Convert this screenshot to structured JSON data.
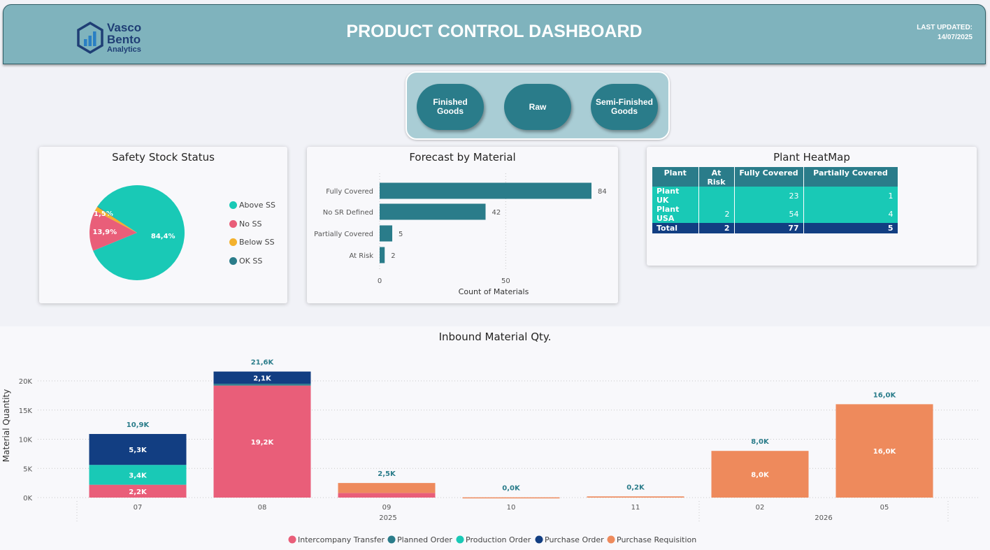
{
  "header": {
    "logo_line1": "Vasco",
    "logo_line2": "Bento",
    "logo_line3": "Analytics",
    "title": "PRODUCT CONTROL DASHBOARD",
    "updated_label": "LAST UPDATED:",
    "updated_value": "14/07/2025"
  },
  "slicer": {
    "buttons": [
      "Finished Goods",
      "Raw",
      "Semi-Finished Goods"
    ]
  },
  "heatmap": {
    "title": "Plant HeatMap",
    "columns": [
      "Plant",
      "At Risk",
      "Fully Covered",
      "Partially Covered"
    ],
    "rows": [
      {
        "plant": "Plant UK",
        "at_risk": "",
        "fully": "23",
        "partially": "1"
      },
      {
        "plant": "Plant USA",
        "at_risk": "2",
        "fully": "54",
        "partially": "4"
      }
    ],
    "total": {
      "plant": "Total",
      "at_risk": "2",
      "fully": "77",
      "partially": "5"
    }
  },
  "colors": {
    "teal": "#19c9b6",
    "pink": "#e95e79",
    "yellow": "#f3b12e",
    "darkteal": "#2a7c8a",
    "navy": "#123e82",
    "orange": "#ee8a5c"
  },
  "chart_data": [
    {
      "type": "pie",
      "title": "Safety Stock Status",
      "labels": [
        "Above SS",
        "No SS",
        "Below SS",
        "OK SS"
      ],
      "values": [
        84.4,
        13.9,
        1.5,
        0.2
      ],
      "data_labels": [
        "84,4%",
        "13,9%",
        "1,5%",
        ""
      ],
      "legend_position": "right"
    },
    {
      "type": "bar",
      "orientation": "horizontal",
      "title": "Forecast by Material",
      "categories": [
        "Fully Covered",
        "No SR Defined",
        "Partially Covered",
        "At Risk"
      ],
      "values": [
        84,
        42,
        5,
        2
      ],
      "xlabel": "Count of Materials",
      "xticks": [
        "0",
        "50"
      ],
      "xlim": [
        0,
        90
      ]
    },
    {
      "type": "bar",
      "stacked": true,
      "title": "Inbound Material Qty.",
      "ylabel": "Material Quantity",
      "categories": [
        "07",
        "08",
        "09",
        "10",
        "11",
        "02",
        "05"
      ],
      "year_groups": [
        {
          "label": "2025",
          "count": 5
        },
        {
          "label": "2026",
          "count": 2
        }
      ],
      "yticks": [
        "0K",
        "5K",
        "10K",
        "15K",
        "20K"
      ],
      "ylim": [
        0,
        22000
      ],
      "series": [
        {
          "name": "Intercompany Transfer",
          "values": [
            2200,
            19200,
            800,
            0,
            0,
            0,
            0
          ],
          "labels": [
            "2,2K",
            "19,2K",
            "",
            "",
            "",
            "",
            ""
          ]
        },
        {
          "name": "Planned Order",
          "values": [
            0,
            300,
            0,
            0,
            0,
            0,
            0
          ],
          "labels": [
            "",
            "",
            "",
            "",
            "",
            "",
            ""
          ]
        },
        {
          "name": "Production Order",
          "values": [
            3400,
            0,
            0,
            0,
            0,
            0,
            0
          ],
          "labels": [
            "3,4K",
            "",
            "",
            "",
            "",
            "",
            ""
          ]
        },
        {
          "name": "Purchase Order",
          "values": [
            5300,
            2100,
            0,
            0,
            0,
            0,
            0
          ],
          "labels": [
            "5,3K",
            "2,1K",
            "",
            "",
            "",
            "",
            ""
          ]
        },
        {
          "name": "Purchase Requisition",
          "values": [
            0,
            0,
            1700,
            40,
            200,
            8000,
            16000
          ],
          "labels": [
            "",
            "",
            "",
            "",
            "",
            "8,0K",
            "16,0K"
          ]
        }
      ],
      "totals": [
        "10,9K",
        "21,6K",
        "2,5K",
        "0,0K",
        "0,2K",
        "8,0K",
        "16,0K"
      ],
      "legend_position": "bottom"
    }
  ]
}
